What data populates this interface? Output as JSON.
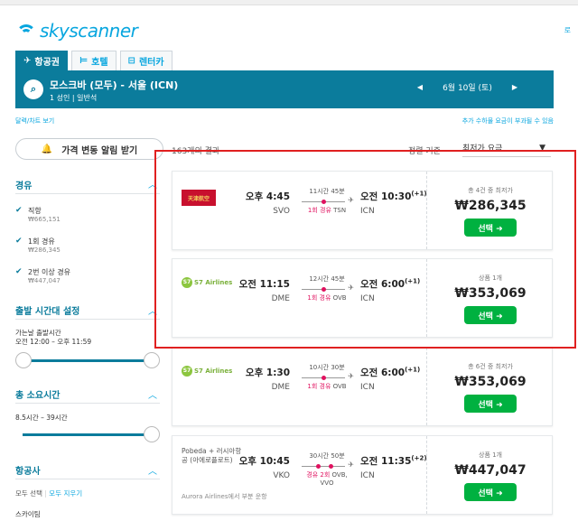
{
  "brand": {
    "name": "skyscanner",
    "color": "#08a6df",
    "corner_link": "로"
  },
  "tabs": [
    {
      "icon": "plane-icon",
      "glyph": "✈",
      "label": "항공권",
      "active": true
    },
    {
      "icon": "bed-icon",
      "glyph": "🛏",
      "label": "호텔",
      "active": false
    },
    {
      "icon": "car-icon",
      "glyph": "🚘",
      "label": "렌터카",
      "active": false
    }
  ],
  "search": {
    "route": "모스크바 (모두) - 서울 (ICN)",
    "passengers": "1 성인  |  일반석",
    "date": "6월 10일 (토)",
    "prev": "◀",
    "next": "▶"
  },
  "links": {
    "date_chart": "달력/차트 보기",
    "fees_note": "추가 수하물 요금이 부과될 수 있음"
  },
  "toolbar": {
    "alert_label": "가격 변동 알림 받기",
    "results_count": "163개의 결과",
    "sort_label": "정렬 기준",
    "sort_value": "최저가 요금"
  },
  "sidebar": {
    "stops_title": "경유",
    "stops": [
      {
        "label": "직항",
        "price": "₩665,151",
        "checked": true
      },
      {
        "label": "1회 경유",
        "price": "₩286,345",
        "checked": true
      },
      {
        "label": "2번 이상 경유",
        "price": "₩447,047",
        "checked": true
      }
    ],
    "times_title": "출발 시간대 설정",
    "times_sub": "가는날 출발시간",
    "times_range": "오전 12:00 – 오후 11:59",
    "duration_title": "총 소요시간",
    "duration_range": "8.5시간 – 39시간",
    "airlines_title": "항공사",
    "select_all": "모두 선택",
    "clear_all": "모두 지우기",
    "first_airline": "스카이팀"
  },
  "results": [
    {
      "airline": "Tianjin Airlines",
      "airline_logo_text": "天津航空",
      "dep_time": "오후 4:45",
      "dep_code": "SVO",
      "duration": "11시간 45분",
      "stops": "1회 경유",
      "via": "TSN",
      "arr_time": "오전 10:30",
      "arr_plus": "(+1)",
      "arr_code": "ICN",
      "note": "총 4건 중 최저가",
      "price": "₩286,345",
      "button": "선택 ➜"
    },
    {
      "airline": "S7 Airlines",
      "dep_time": "오전 11:15",
      "dep_code": "DME",
      "duration": "12시간 45분",
      "stops": "1회 경유",
      "via": "OVB",
      "arr_time": "오전 6:00",
      "arr_plus": "(+1)",
      "arr_code": "ICN",
      "note": "상품 1개",
      "price": "₩353,069",
      "button": "선택 ➜"
    },
    {
      "airline": "S7 Airlines",
      "dep_time": "오후 1:30",
      "dep_code": "DME",
      "duration": "10시간 30분",
      "stops": "1회 경유",
      "via": "OVB",
      "arr_time": "오전 6:00",
      "arr_plus": "(+1)",
      "arr_code": "ICN",
      "note": "총 6건 중 최저가",
      "price": "₩353,069",
      "button": "선택 ➜"
    },
    {
      "airline": "Pobeda + 러시아항공 (아에로플로트)",
      "operated": "Aurora Airlines에서 부분 운항",
      "dep_time": "오후 10:45",
      "dep_code": "VKO",
      "duration": "30시간 50분",
      "stops": "경유 2회",
      "via": "OVB,",
      "via2": "VVO",
      "arr_time": "오전 11:35",
      "arr_plus": "(+2)",
      "arr_code": "ICN",
      "note": "상품 1개",
      "price": "₩447,047",
      "button": "선택 ➜"
    }
  ]
}
